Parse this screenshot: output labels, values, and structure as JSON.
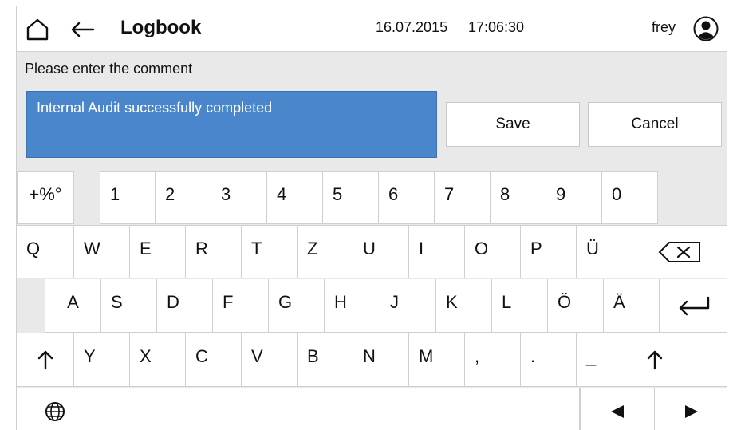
{
  "header": {
    "title": "Logbook",
    "date": "16.07.2015",
    "time": "17:06:30",
    "user": "frey",
    "icons": [
      "home-icon",
      "back-arrow-icon",
      "user-avatar-icon"
    ]
  },
  "form": {
    "prompt": "Please enter the comment",
    "comment_value": "Internal Audit successfully completed",
    "save_label": "Save",
    "cancel_label": "Cancel"
  },
  "keyboard": {
    "symbols_key": "+%°",
    "digits": [
      "1",
      "2",
      "3",
      "4",
      "5",
      "6",
      "7",
      "8",
      "9",
      "0"
    ],
    "row_q": [
      "Q",
      "W",
      "E",
      "R",
      "T",
      "Z",
      "U",
      "I",
      "O",
      "P",
      "Ü"
    ],
    "row_a": [
      "A",
      "S",
      "D",
      "F",
      "G",
      "H",
      "J",
      "K",
      "L",
      "Ö",
      "Ä"
    ],
    "row_y": [
      "Y",
      "X",
      "C",
      "V",
      "B",
      "N",
      "M",
      ",",
      ".",
      "_"
    ],
    "special_icons": [
      "backspace-icon",
      "enter-icon",
      "shift-icon",
      "globe-icon",
      "arrow-left-icon",
      "arrow-right-icon"
    ]
  },
  "colors": {
    "comment_bg": "#4a86cc",
    "keyboard_bg": "#e9e9e9",
    "key_bg": "#ffffff"
  }
}
